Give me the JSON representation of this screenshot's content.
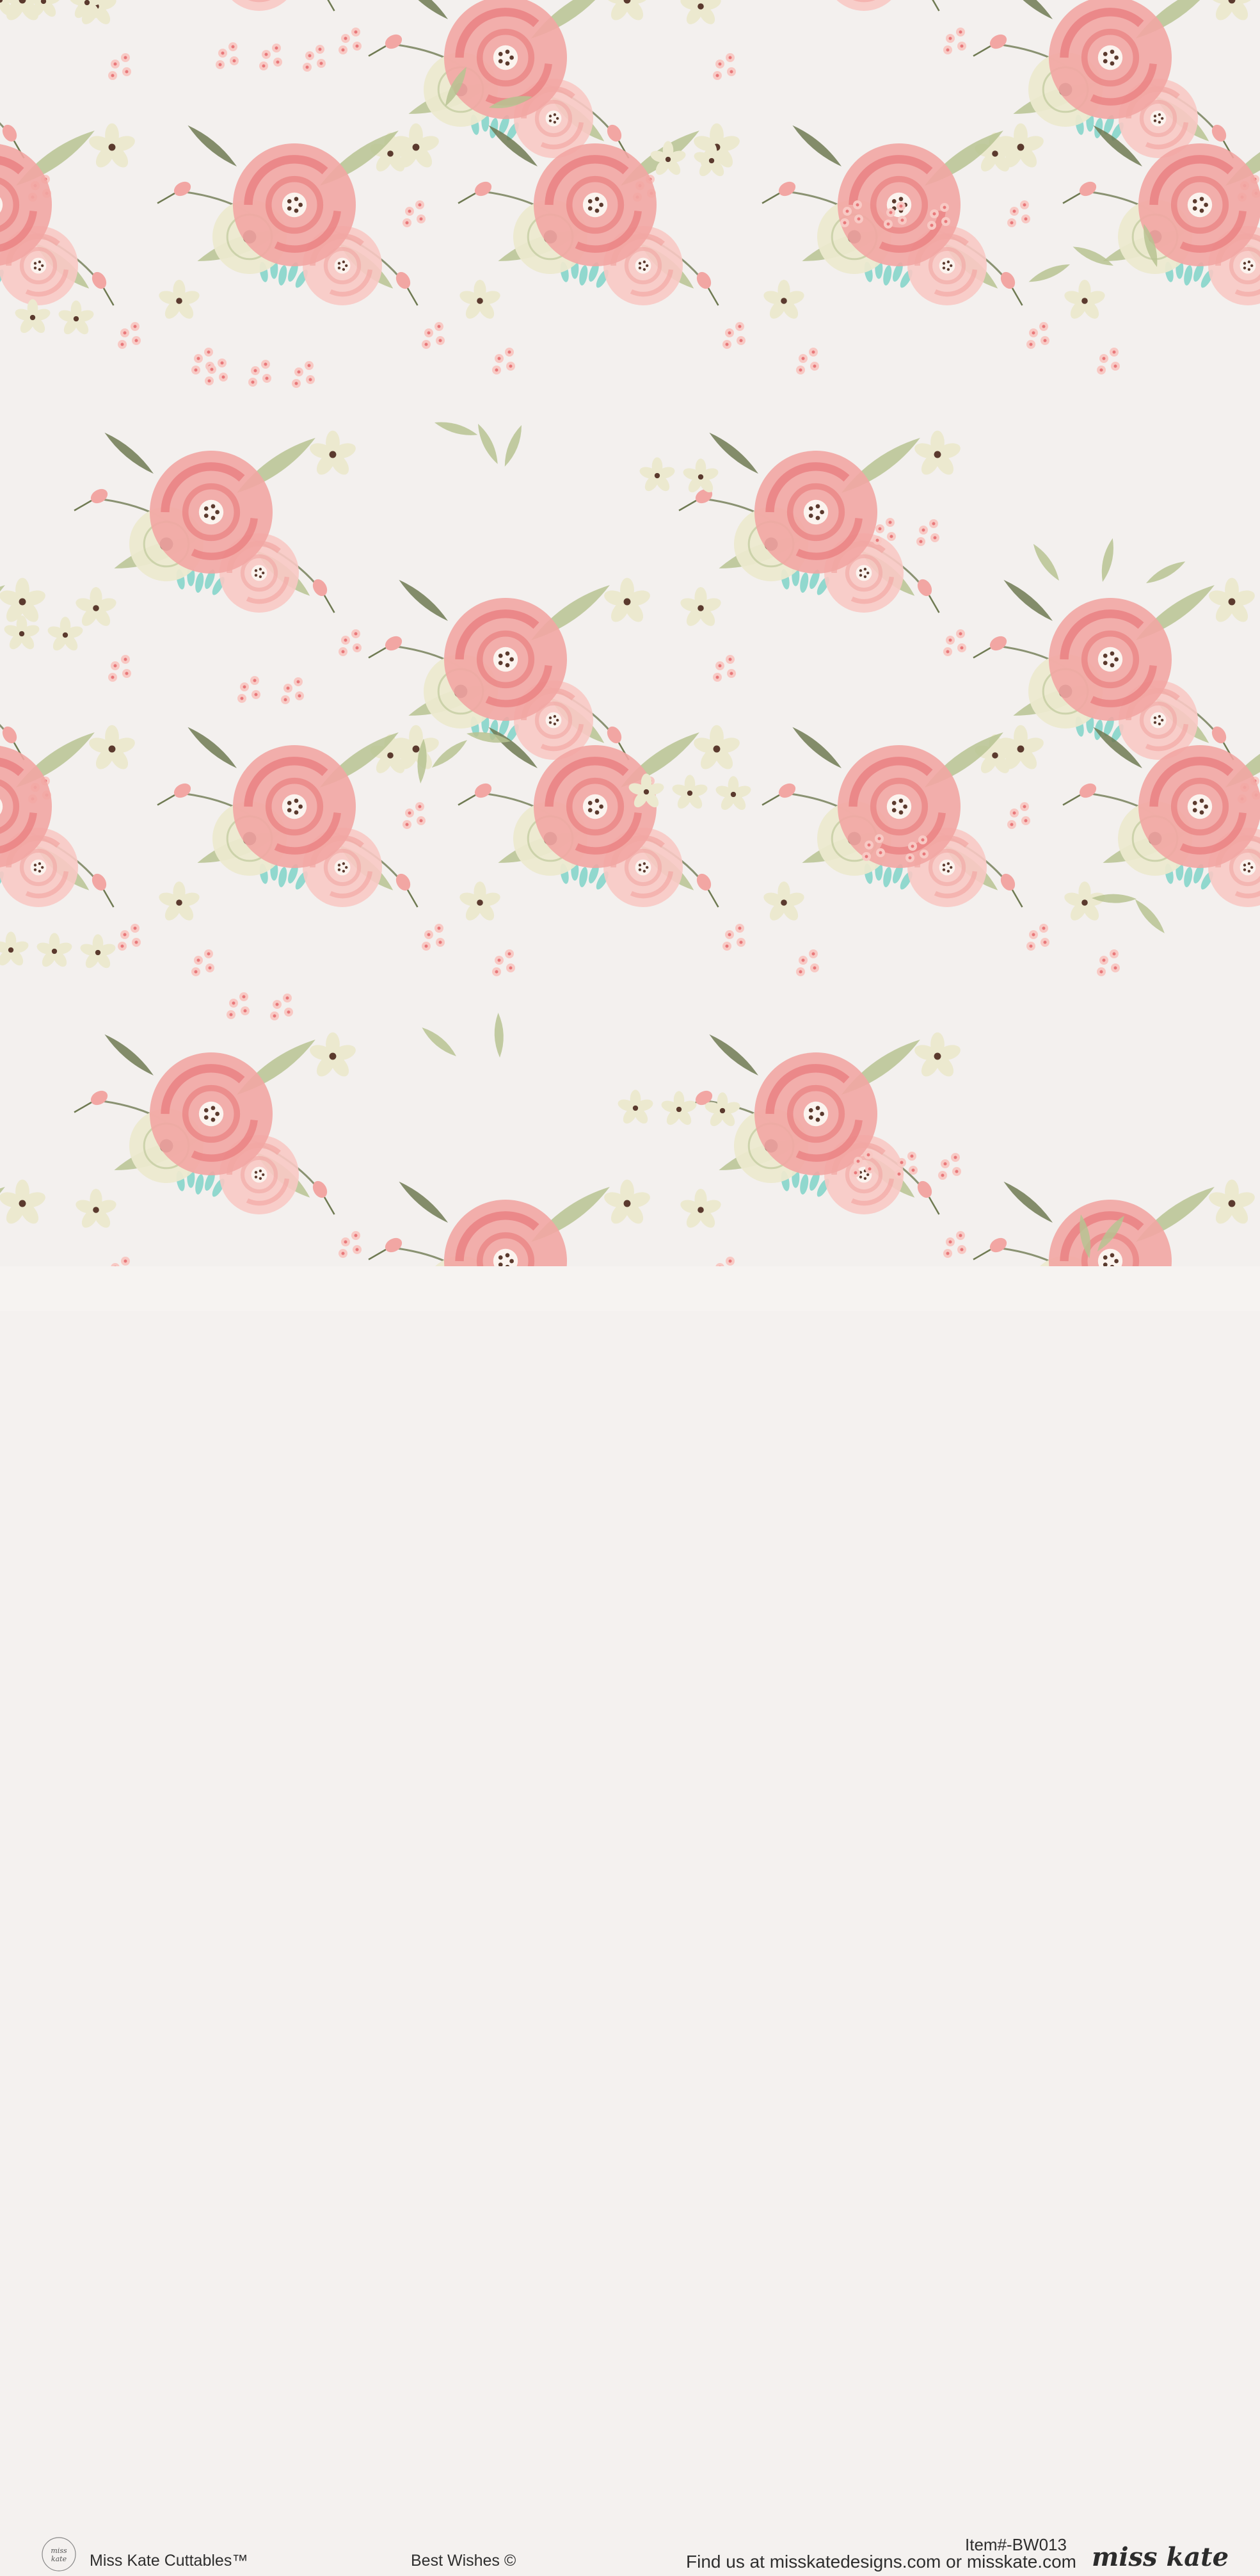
{
  "footer": {
    "brand_mark_text": "miss kate",
    "brand_name": "Miss Kate Cuttables™",
    "collection": "Best Wishes ©",
    "item_number": "Item#-BW013",
    "find_us": "Find us at misskatedesigns.com or misskate.com",
    "signature": "miss kate"
  },
  "palette": {
    "background": "#f3f0ee",
    "rose_deep": "#e8787a",
    "rose_mid": "#f2a6a3",
    "rose_light": "#f8c9c4",
    "cream": "#ece9cf",
    "leaf_green": "#b7c392",
    "leaf_dark": "#6f7a52",
    "aqua": "#7fd3c8",
    "center_brown": "#5b3a2e"
  }
}
